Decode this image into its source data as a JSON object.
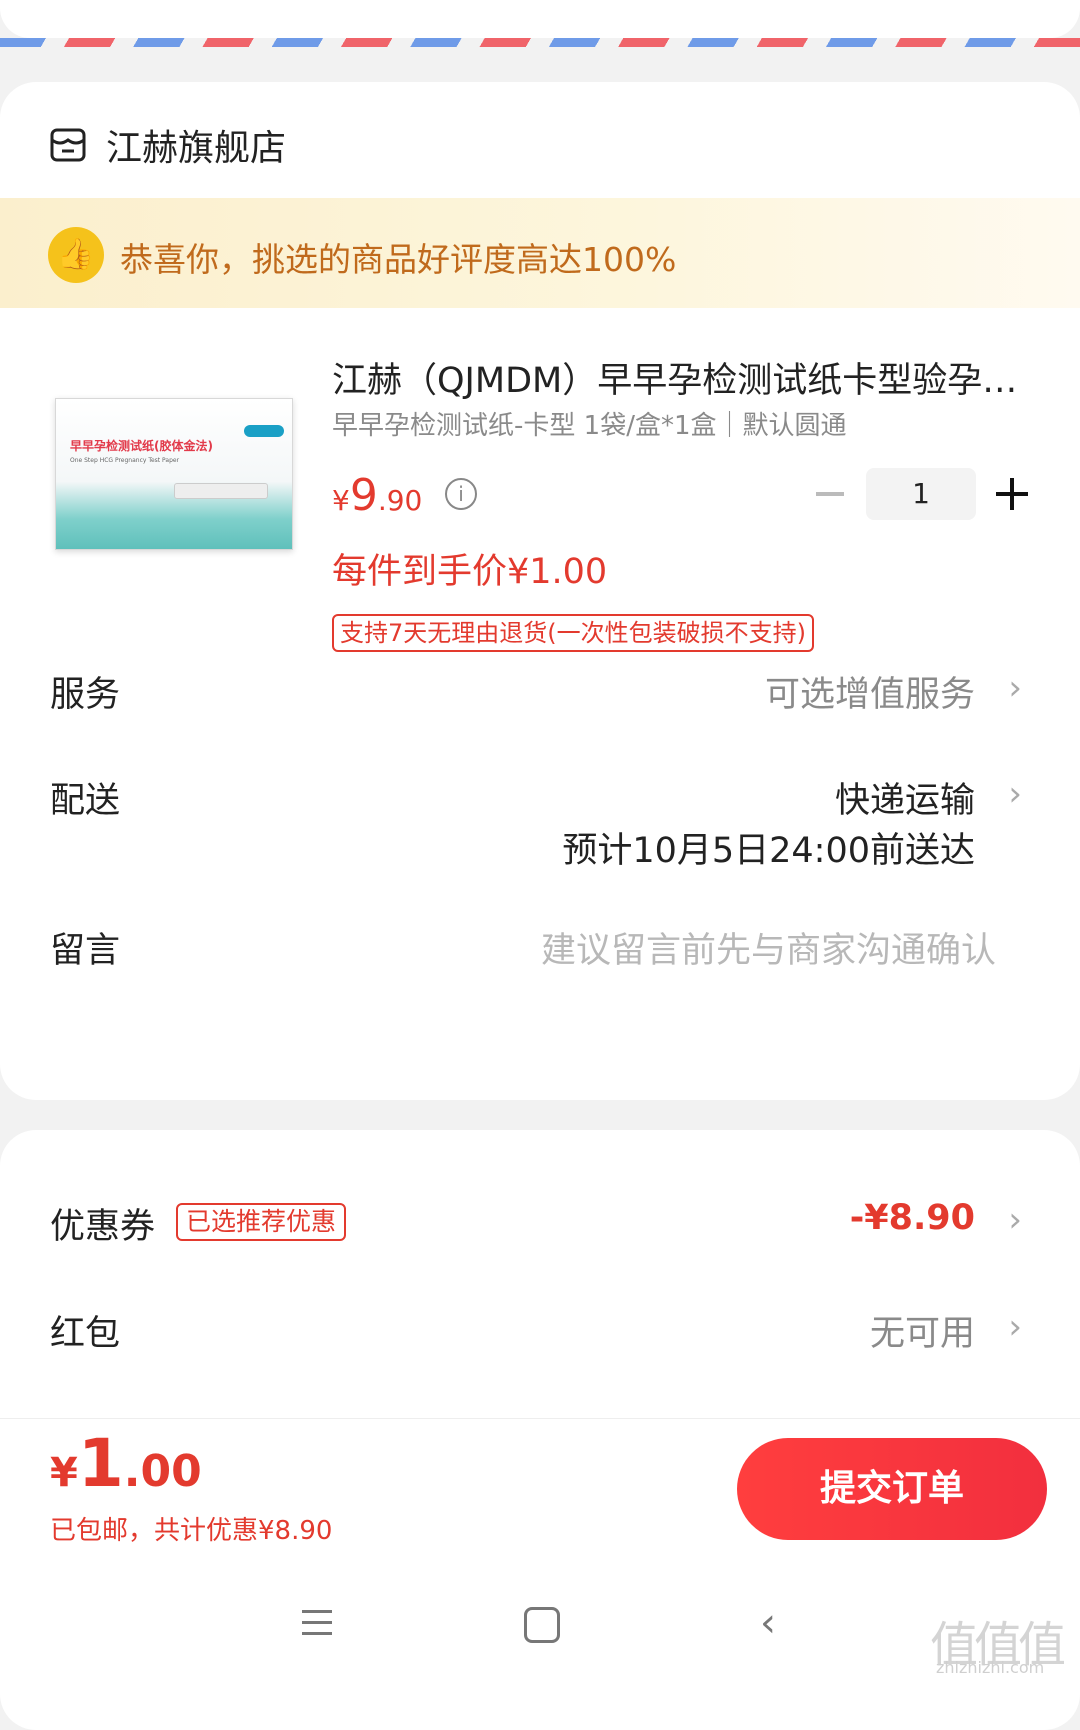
{
  "shop": {
    "name": "江赫旗舰店",
    "icon": "store-icon"
  },
  "banner": {
    "text": "恭喜你，挑选的商品好评度高达100%",
    "icon": "thumbs-up-icon"
  },
  "product": {
    "title": "江赫（QJMDM）早早孕检测试纸卡型验孕…",
    "spec": "早早孕检测试纸-卡型 1袋/盒*1盒｜默认圆通",
    "price_symbol": "¥",
    "price_int": "9",
    "price_dec": ".90",
    "quantity": "1",
    "unit_price": "每件到手价¥1.00",
    "return_policy": "支持7天无理由退货(一次性包装破损不支持)",
    "image_text": {
      "title": "早早孕检测试纸(胶体金法)",
      "sub": "One Step HCG Pregnancy Test Paper"
    }
  },
  "rows": {
    "service": {
      "label": "服务",
      "value": "可选增值服务"
    },
    "delivery": {
      "label": "配送",
      "value": "快递运输",
      "eta": "预计10月5日24:00前送达"
    },
    "message": {
      "label": "留言",
      "placeholder": "建议留言前先与商家沟通确认"
    },
    "coupon": {
      "label": "优惠券",
      "tag": "已选推荐优惠",
      "value": "-¥8.90"
    },
    "redpacket": {
      "label": "红包",
      "value": "无可用"
    }
  },
  "footer": {
    "total_symbol": "¥",
    "total_int": "1",
    "total_dec": ".00",
    "shipping_prefix": "已包邮，",
    "shipping_discount": "共计优惠¥8.90",
    "submit_label": "提交订单"
  },
  "watermark": {
    "text": "值值值",
    "url": "zhizhizhi.com"
  },
  "colors": {
    "accent": "#e33a2e",
    "banner_text": "#c06a1c",
    "submit": "#f22f3e"
  }
}
